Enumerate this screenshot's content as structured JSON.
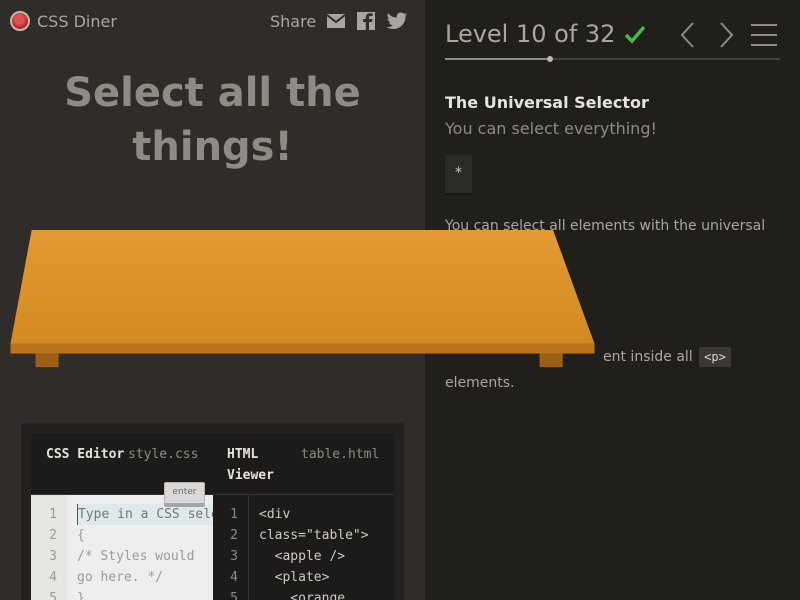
{
  "app": {
    "name": "CSS Diner"
  },
  "share": {
    "label": "Share"
  },
  "level_instructions": "Select all the things!",
  "header": {
    "level_label": "Level 10 of 32",
    "completed": true
  },
  "progress": {
    "current": 10,
    "total": 32
  },
  "lesson": {
    "name": "The Universal Selector",
    "title": "You can select everything!",
    "syntax": "*",
    "help_1": "You can select all elements with the universal",
    "example_text_end": "ent inside all",
    "example_tag": "<p>",
    "example_text_2": "elements."
  },
  "editor": {
    "css_title": "CSS Editor",
    "css_file": "style.css",
    "html_title_1": "HTML",
    "html_title_2": "Viewer",
    "html_file": "table.html",
    "input_placeholder": "Type in a CSS selector",
    "enter_label": "enter",
    "css_line_numbers": "1\n2\n3\n4\n5",
    "css_lines": "{\n/* Styles would\ngo here. */\n}",
    "html_line_numbers": "1\n2\n3\n4\n5",
    "html_lines": "<div\nclass=\"table\">\n  <apple />\n  <plate>\n    <orange"
  },
  "colors": {
    "accent": "#e1962f",
    "check": "#4cb849"
  }
}
